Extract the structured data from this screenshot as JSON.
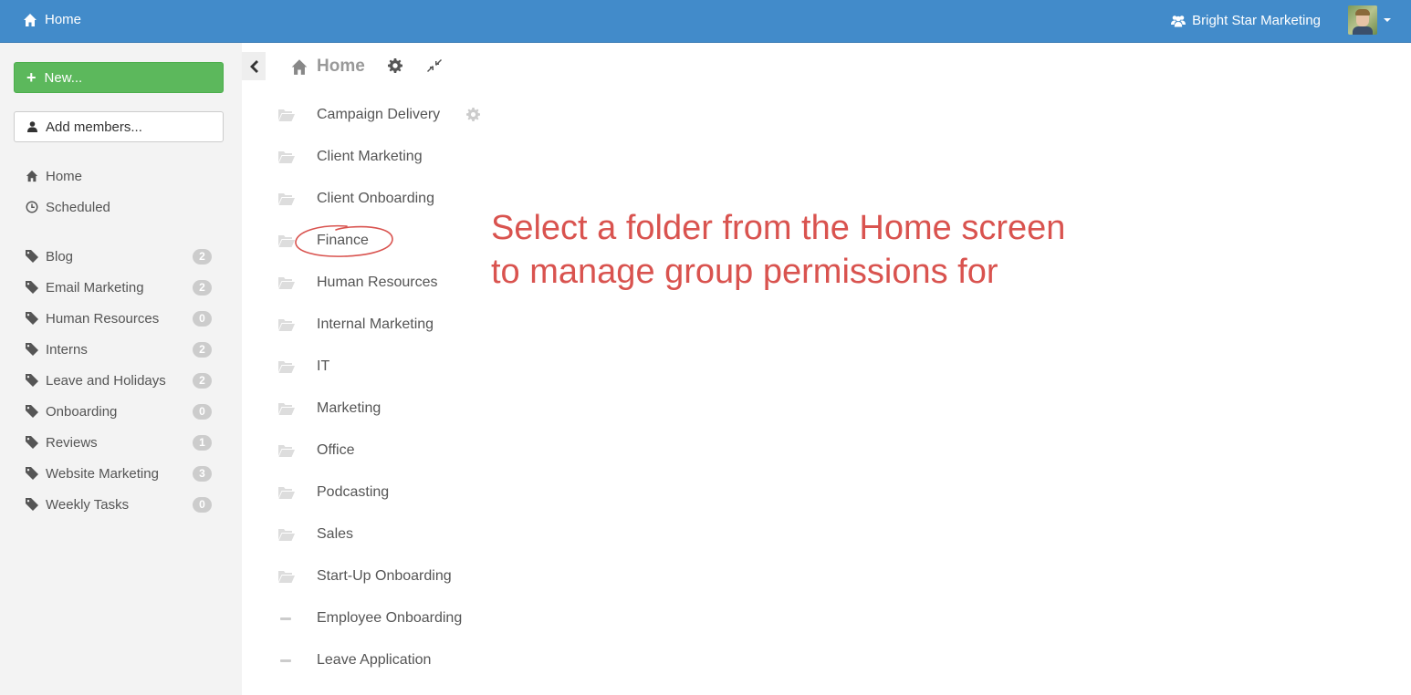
{
  "topbar": {
    "home_label": "Home",
    "org_name": "Bright Star Marketing",
    "bg_color": "#428bca"
  },
  "sidebar": {
    "new_button_label": "New...",
    "add_members_label": "Add members...",
    "nav": [
      {
        "label": "Home",
        "icon": "home-icon"
      },
      {
        "label": "Scheduled",
        "icon": "clock-icon"
      }
    ],
    "tags": [
      {
        "label": "Blog",
        "count": "2"
      },
      {
        "label": "Email Marketing",
        "count": "2"
      },
      {
        "label": "Human Resources",
        "count": "0"
      },
      {
        "label": "Interns",
        "count": "2"
      },
      {
        "label": "Leave and Holidays",
        "count": "2"
      },
      {
        "label": "Onboarding",
        "count": "0"
      },
      {
        "label": "Reviews",
        "count": "1"
      },
      {
        "label": "Website Marketing",
        "count": "3"
      },
      {
        "label": "Weekly Tasks",
        "count": "0"
      }
    ]
  },
  "main": {
    "title": "Home",
    "folders": [
      "Campaign Delivery",
      "Client Marketing",
      "Client Onboarding",
      "Finance",
      "Human Resources",
      "Internal Marketing",
      "IT",
      "Marketing",
      "Office",
      "Podcasting",
      "Sales",
      "Start-Up Onboarding"
    ],
    "items": [
      "Employee Onboarding",
      "Leave Application"
    ]
  },
  "annotation": {
    "line1": "Select a folder from the Home screen",
    "line2": "to manage group permissions for",
    "color": "#d9534f"
  }
}
